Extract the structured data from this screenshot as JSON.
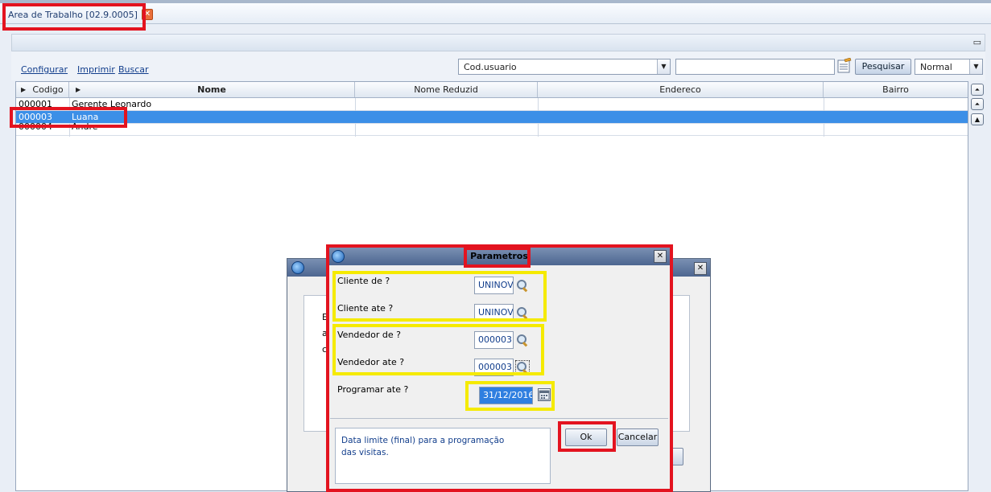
{
  "workspace_tab": {
    "label": "Area de Trabalho [02.9.0005]",
    "close_glyph": "✕"
  },
  "toolbar": {
    "links": [
      "Configurar",
      "Imprimir",
      "Buscar"
    ],
    "search_field_combo": "Cod.usuario",
    "search_value": "",
    "search_button": "Pesquisar",
    "view_mode": "Normal"
  },
  "grid": {
    "columns": [
      "Codigo",
      "Nome",
      "Nome Reduzid",
      "Endereco",
      "Bairro"
    ],
    "rows": [
      {
        "codigo": "000001",
        "nome": "Gerente Leonardo"
      },
      {
        "codigo": "000003",
        "nome": "Luana"
      },
      {
        "codigo": "000004",
        "nome": "Andre"
      }
    ],
    "selected_row": 1
  },
  "back_dialog": {
    "text_fragments": [
      "E",
      "a",
      "c"
    ]
  },
  "dialog": {
    "title": "Parametros",
    "fields": [
      {
        "label": "Cliente de ?",
        "value": "UNINOV"
      },
      {
        "label": "Cliente ate ?",
        "value": "UNINOV"
      },
      {
        "label": "Vendedor de ?",
        "value": "000003"
      },
      {
        "label": "Vendedor ate ?",
        "value": "000003"
      },
      {
        "label": "Programar ate ?",
        "value": "31/12/2016"
      }
    ],
    "help_text_line1": "Data limite (final) para a programação",
    "help_text_line2": "das visitas.",
    "ok_label": "Ok",
    "cancel_label": "Cancelar"
  },
  "colors": {
    "highlight_red": "#e3131f",
    "highlight_yellow": "#f5ea00",
    "selection": "#3c8fe7"
  }
}
